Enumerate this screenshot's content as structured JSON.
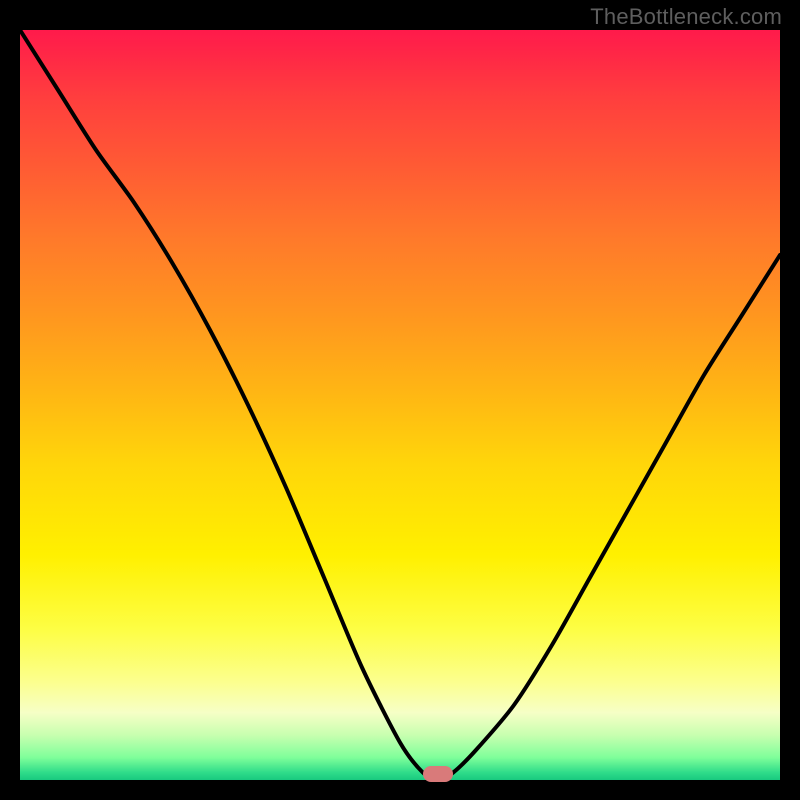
{
  "attribution": "TheBottleneck.com",
  "colors": {
    "frame_bg": "#000000",
    "attribution_text": "#5e5e5e",
    "curve_stroke": "#000000",
    "marker_fill": "#d97a7a",
    "gradient_top": "#ff1a4b",
    "gradient_mid": "#fff000",
    "gradient_bottom": "#18c97f"
  },
  "chart_data": {
    "type": "line",
    "title": "",
    "xlabel": "",
    "ylabel": "",
    "xlim": [
      0,
      100
    ],
    "ylim": [
      0,
      100
    ],
    "grid": false,
    "legend": false,
    "note": "x and y are percentage positions within the plot area (0 = left/top, 100 = right/bottom); y estimated from curve pixel height; background is a vertical color gradient from red (top) through yellow to green (bottom)",
    "series": [
      {
        "name": "bottleneck-curve",
        "x": [
          0,
          5,
          10,
          15,
          20,
          25,
          30,
          35,
          40,
          45,
          50,
          53,
          55,
          57,
          60,
          65,
          70,
          75,
          80,
          85,
          90,
          95,
          100
        ],
        "y": [
          0,
          8,
          16,
          23,
          31,
          40,
          50,
          61,
          73,
          85,
          95,
          99,
          100,
          99,
          96,
          90,
          82,
          73,
          64,
          55,
          46,
          38,
          30
        ]
      }
    ],
    "marker": {
      "name": "dip-marker",
      "x": 55,
      "y": 100,
      "shape": "rounded-rect",
      "color": "#d97a7a"
    }
  }
}
